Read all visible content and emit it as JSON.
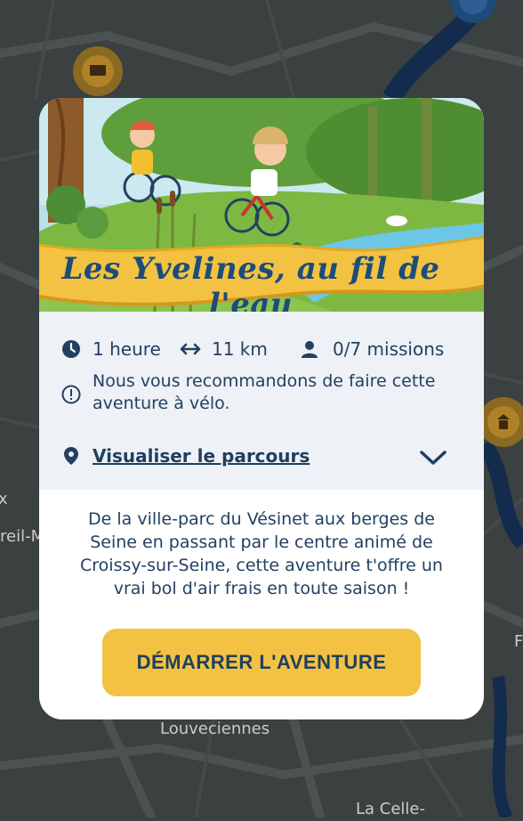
{
  "map": {
    "labels": [
      "x",
      "reil-M",
      "Louveciennes",
      "La Celle-",
      "F"
    ]
  },
  "card": {
    "title": "Les Yvelines, au fil de l'eau",
    "stats": {
      "duration": "1 heure",
      "distance": "11 km",
      "missions": "0/7 missions"
    },
    "recommendation": "Nous vous recommandons de faire cette aventure à vélo.",
    "route_link": "Visualiser le parcours",
    "description": "De la ville-parc du Vésinet aux berges de Seine en passant par le centre animé de Croissy-sur-Seine, cette aventure t'offre un vrai bol d'air frais en toute saison !",
    "cta": "DÉMARRER L'AVENTURE"
  },
  "icons": {
    "clock": "clock-icon",
    "distance": "double-arrow-icon",
    "missions": "user-icon",
    "info": "info-circle-icon",
    "location": "location-pin-icon",
    "expand": "chevron-down-icon"
  },
  "colors": {
    "primary": "#234063",
    "accent": "#f3c242",
    "map_background": "#3b4040"
  }
}
